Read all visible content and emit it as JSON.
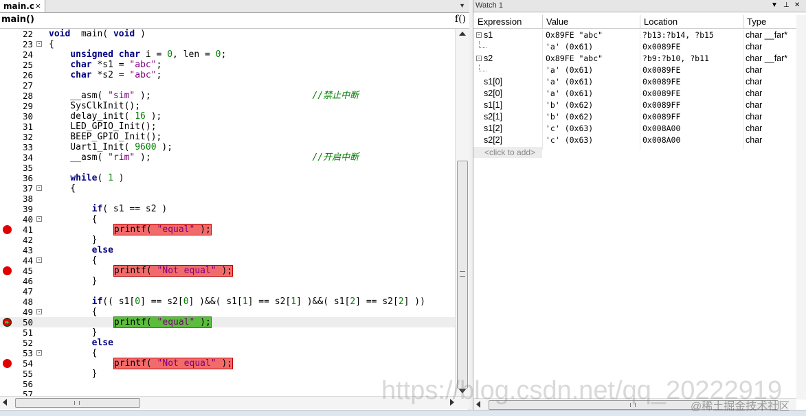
{
  "editor": {
    "tab_label": "main.c",
    "tab_close": "×",
    "function_name": "main()",
    "function_icon": "f()",
    "lines": [
      {
        "n": "22",
        "fold": "",
        "marker": "",
        "hl": "",
        "segs": [
          [
            "kw",
            "void"
          ],
          [
            "",
            "  main( "
          ],
          [
            "kw",
            "void"
          ],
          [
            "",
            " )"
          ]
        ]
      },
      {
        "n": "23",
        "fold": "-",
        "marker": "",
        "hl": "",
        "segs": [
          [
            "",
            "{"
          ]
        ]
      },
      {
        "n": "24",
        "fold": "",
        "marker": "",
        "hl": "",
        "segs": [
          [
            "",
            "    "
          ],
          [
            "kw",
            "unsigned char"
          ],
          [
            "",
            " i = "
          ],
          [
            "num",
            "0"
          ],
          [
            "",
            ", len = "
          ],
          [
            "num",
            "0"
          ],
          [
            "",
            ";"
          ]
        ]
      },
      {
        "n": "25",
        "fold": "",
        "marker": "",
        "hl": "",
        "segs": [
          [
            "",
            "    "
          ],
          [
            "kw",
            "char"
          ],
          [
            "",
            " *s1 = "
          ],
          [
            "str",
            "\"abc\""
          ],
          [
            "",
            ";"
          ]
        ]
      },
      {
        "n": "26",
        "fold": "",
        "marker": "",
        "hl": "",
        "segs": [
          [
            "",
            "    "
          ],
          [
            "kw",
            "char"
          ],
          [
            "",
            " *s2 = "
          ],
          [
            "str",
            "\"abc\""
          ],
          [
            "",
            ";"
          ]
        ]
      },
      {
        "n": "27",
        "fold": "",
        "marker": "",
        "hl": "",
        "segs": []
      },
      {
        "n": "28",
        "fold": "",
        "marker": "",
        "hl": "",
        "segs": [
          [
            "",
            "    __asm( "
          ],
          [
            "str",
            "\"sim\""
          ],
          [
            "",
            " );                              "
          ],
          [
            "cmt",
            "//禁止中断"
          ]
        ]
      },
      {
        "n": "29",
        "fold": "",
        "marker": "",
        "hl": "",
        "segs": [
          [
            "",
            "    SysClkInit();"
          ]
        ]
      },
      {
        "n": "30",
        "fold": "",
        "marker": "",
        "hl": "",
        "segs": [
          [
            "",
            "    delay_init( "
          ],
          [
            "num",
            "16"
          ],
          [
            "",
            " );"
          ]
        ]
      },
      {
        "n": "31",
        "fold": "",
        "marker": "",
        "hl": "",
        "segs": [
          [
            "",
            "    LED_GPIO_Init();"
          ]
        ]
      },
      {
        "n": "32",
        "fold": "",
        "marker": "",
        "hl": "",
        "segs": [
          [
            "",
            "    BEEP_GPIO_Init();"
          ]
        ]
      },
      {
        "n": "33",
        "fold": "",
        "marker": "",
        "hl": "",
        "segs": [
          [
            "",
            "    Uart1_Init( "
          ],
          [
            "num",
            "9600"
          ],
          [
            "",
            " );"
          ]
        ]
      },
      {
        "n": "34",
        "fold": "",
        "marker": "",
        "hl": "",
        "segs": [
          [
            "",
            "    __asm( "
          ],
          [
            "str",
            "\"rim\""
          ],
          [
            "",
            " );                              "
          ],
          [
            "cmt",
            "//开启中断"
          ]
        ]
      },
      {
        "n": "35",
        "fold": "",
        "marker": "",
        "hl": "",
        "segs": []
      },
      {
        "n": "36",
        "fold": "",
        "marker": "",
        "hl": "",
        "segs": [
          [
            "",
            "    "
          ],
          [
            "kw",
            "while"
          ],
          [
            "",
            "( "
          ],
          [
            "num",
            "1"
          ],
          [
            "",
            " )"
          ]
        ]
      },
      {
        "n": "37",
        "fold": "-",
        "marker": "",
        "hl": "",
        "segs": [
          [
            "",
            "    {"
          ]
        ]
      },
      {
        "n": "38",
        "fold": "",
        "marker": "",
        "hl": "",
        "segs": []
      },
      {
        "n": "39",
        "fold": "",
        "marker": "",
        "hl": "",
        "segs": [
          [
            "",
            "        "
          ],
          [
            "kw",
            "if"
          ],
          [
            "",
            "( s1 == s2 )"
          ]
        ]
      },
      {
        "n": "40",
        "fold": "-",
        "marker": "",
        "hl": "",
        "segs": [
          [
            "",
            "        {"
          ]
        ]
      },
      {
        "n": "41",
        "fold": "",
        "marker": "bp",
        "hl": "red",
        "segs": [
          [
            "",
            "printf( "
          ],
          [
            "str",
            "\"equal\""
          ],
          [
            "",
            " );"
          ]
        ]
      },
      {
        "n": "42",
        "fold": "",
        "marker": "",
        "hl": "",
        "segs": [
          [
            "",
            "        }"
          ]
        ]
      },
      {
        "n": "43",
        "fold": "",
        "marker": "",
        "hl": "",
        "segs": [
          [
            "",
            "        "
          ],
          [
            "kw",
            "else"
          ]
        ]
      },
      {
        "n": "44",
        "fold": "-",
        "marker": "",
        "hl": "",
        "segs": [
          [
            "",
            "        {"
          ]
        ]
      },
      {
        "n": "45",
        "fold": "",
        "marker": "bp",
        "hl": "red",
        "segs": [
          [
            "",
            "printf( "
          ],
          [
            "str",
            "\"Not equal\""
          ],
          [
            "",
            " );"
          ]
        ]
      },
      {
        "n": "46",
        "fold": "",
        "marker": "",
        "hl": "",
        "segs": [
          [
            "",
            "        }"
          ]
        ]
      },
      {
        "n": "47",
        "fold": "",
        "marker": "",
        "hl": "",
        "segs": []
      },
      {
        "n": "48",
        "fold": "",
        "marker": "",
        "hl": "",
        "segs": [
          [
            "",
            "        "
          ],
          [
            "kw",
            "if"
          ],
          [
            "",
            "(( s1["
          ],
          [
            "num",
            "0"
          ],
          [
            "",
            "] == s2["
          ],
          [
            "num",
            "0"
          ],
          [
            "",
            "] )&&( s1["
          ],
          [
            "num",
            "1"
          ],
          [
            "",
            "] == s2["
          ],
          [
            "num",
            "1"
          ],
          [
            "",
            "] )&&( s1["
          ],
          [
            "num",
            "2"
          ],
          [
            "",
            "] == s2["
          ],
          [
            "num",
            "2"
          ],
          [
            "",
            "] ))"
          ]
        ]
      },
      {
        "n": "49",
        "fold": "-",
        "marker": "",
        "hl": "",
        "segs": [
          [
            "",
            "        {"
          ]
        ]
      },
      {
        "n": "50",
        "fold": "",
        "marker": "cur",
        "hl": "green",
        "segs": [
          [
            "",
            "printf( "
          ],
          [
            "str",
            "\"equal\""
          ],
          [
            "",
            " );"
          ]
        ]
      },
      {
        "n": "51",
        "fold": "",
        "marker": "",
        "hl": "",
        "segs": [
          [
            "",
            "        }"
          ]
        ]
      },
      {
        "n": "52",
        "fold": "",
        "marker": "",
        "hl": "",
        "segs": [
          [
            "",
            "        "
          ],
          [
            "kw",
            "else"
          ]
        ]
      },
      {
        "n": "53",
        "fold": "-",
        "marker": "",
        "hl": "",
        "segs": [
          [
            "",
            "        {"
          ]
        ]
      },
      {
        "n": "54",
        "fold": "",
        "marker": "bp",
        "hl": "red",
        "segs": [
          [
            "",
            "printf( "
          ],
          [
            "str",
            "\"Not equal\""
          ],
          [
            "",
            " );"
          ]
        ]
      },
      {
        "n": "55",
        "fold": "",
        "marker": "",
        "hl": "",
        "segs": [
          [
            "",
            "        }"
          ]
        ]
      },
      {
        "n": "56",
        "fold": "",
        "marker": "",
        "hl": "",
        "segs": []
      },
      {
        "n": "57",
        "fold": "",
        "marker": "",
        "hl": "",
        "segs": []
      }
    ]
  },
  "watch": {
    "title": "Watch 1",
    "columns": [
      "Expression",
      "Value",
      "Location",
      "Type"
    ],
    "rows": [
      {
        "expand": "-",
        "tree": false,
        "expr": "s1",
        "value": "0x89FE \"abc\"",
        "location": "?b13:?b14, ?b15",
        "type": "char __far*"
      },
      {
        "expand": "",
        "tree": true,
        "expr": "",
        "value": "'a' (0x61)",
        "location": "0x0089FE",
        "type": "char"
      },
      {
        "expand": "-",
        "tree": false,
        "expr": "s2",
        "value": "0x89FE \"abc\"",
        "location": "?b9:?b10, ?b11",
        "type": "char __far*"
      },
      {
        "expand": "",
        "tree": true,
        "expr": "",
        "value": "'a' (0x61)",
        "location": "0x0089FE",
        "type": "char"
      },
      {
        "expand": "",
        "tree": false,
        "expr": "s1[0]",
        "value": "'a' (0x61)",
        "location": "0x0089FE",
        "type": "char"
      },
      {
        "expand": "",
        "tree": false,
        "expr": "s2[0]",
        "value": "'a' (0x61)",
        "location": "0x0089FE",
        "type": "char"
      },
      {
        "expand": "",
        "tree": false,
        "expr": "s1[1]",
        "value": "'b' (0x62)",
        "location": "0x0089FF",
        "type": "char"
      },
      {
        "expand": "",
        "tree": false,
        "expr": "s2[1]",
        "value": "'b' (0x62)",
        "location": "0x0089FF",
        "type": "char"
      },
      {
        "expand": "",
        "tree": false,
        "expr": "s1[2]",
        "value": "'c' (0x63)",
        "location": "0x008A00",
        "type": "char"
      },
      {
        "expand": "",
        "tree": false,
        "expr": "s2[2]",
        "value": "'c' (0x63)",
        "location": "0x008A00",
        "type": "char"
      }
    ],
    "click_to_add": "<click to add>"
  },
  "watermark": "https://blog.csdn.net/qq_20222919",
  "watermark_badge": "@稀土掘金技术社区",
  "colors": {
    "breakpoint": "#e00000",
    "breakpoint_highlight": "#f26b6b",
    "current_line_highlight": "#5bbd3c",
    "keyword": "#000080",
    "string": "#800080",
    "comment": "#008000"
  }
}
